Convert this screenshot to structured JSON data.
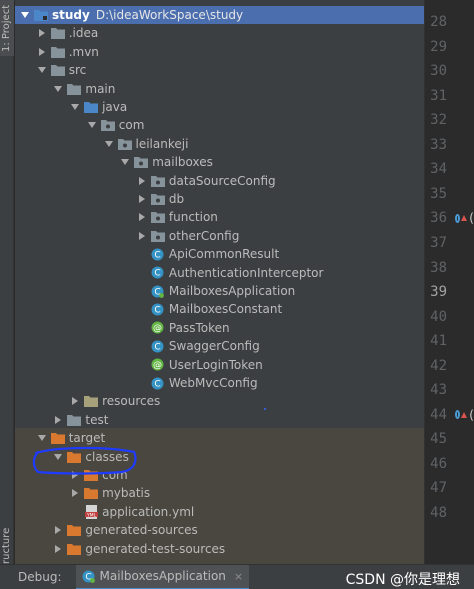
{
  "sidebar": {
    "project_tab": "1: Project",
    "structure_tab": "ructure"
  },
  "tree": [
    {
      "label": "study",
      "path": "D:\\ideaWorkSpace\\study",
      "arrow": "down",
      "icon": "module-folder-icon",
      "level": 0,
      "selected": true
    },
    {
      "label": ".idea",
      "arrow": "right",
      "icon": "folder-icon",
      "level": 1
    },
    {
      "label": ".mvn",
      "arrow": "right",
      "icon": "folder-icon",
      "level": 1
    },
    {
      "label": "src",
      "arrow": "down",
      "icon": "folder-icon",
      "level": 1
    },
    {
      "label": "main",
      "arrow": "down",
      "icon": "folder-icon",
      "level": 2
    },
    {
      "label": "java",
      "arrow": "down",
      "icon": "source-folder-icon",
      "level": 3
    },
    {
      "label": "com",
      "arrow": "down",
      "icon": "package-icon",
      "level": 4
    },
    {
      "label": "leilankeji",
      "arrow": "down",
      "icon": "package-icon",
      "level": 5
    },
    {
      "label": "mailboxes",
      "arrow": "down",
      "icon": "package-icon",
      "level": 6
    },
    {
      "label": "dataSourceConfig",
      "arrow": "right",
      "icon": "package-icon",
      "level": 7
    },
    {
      "label": "db",
      "arrow": "right",
      "icon": "package-icon",
      "level": 7
    },
    {
      "label": "function",
      "arrow": "right",
      "icon": "package-icon",
      "level": 7
    },
    {
      "label": "otherConfig",
      "arrow": "right",
      "icon": "package-icon",
      "level": 7
    },
    {
      "label": "ApiCommonResult",
      "arrow": "none",
      "icon": "class-icon",
      "level": 7
    },
    {
      "label": "AuthenticationInterceptor",
      "arrow": "none",
      "icon": "class-icon",
      "level": 7
    },
    {
      "label": "MailboxesApplication",
      "arrow": "none",
      "icon": "spring-boot-class-icon",
      "level": 7
    },
    {
      "label": "MailboxesConstant",
      "arrow": "none",
      "icon": "class-icon",
      "level": 7
    },
    {
      "label": "PassToken",
      "arrow": "none",
      "icon": "annotation-icon",
      "level": 7
    },
    {
      "label": "SwaggerConfig",
      "arrow": "none",
      "icon": "class-icon",
      "level": 7
    },
    {
      "label": "UserLoginToken",
      "arrow": "none",
      "icon": "annotation-icon",
      "level": 7
    },
    {
      "label": "WebMvcConfig",
      "arrow": "none",
      "icon": "class-icon",
      "level": 7
    },
    {
      "label": "resources",
      "arrow": "right",
      "icon": "resources-folder-icon",
      "level": 3
    },
    {
      "label": "test",
      "arrow": "right",
      "icon": "folder-icon",
      "level": 2
    },
    {
      "label": "target",
      "arrow": "down",
      "icon": "excluded-folder-icon",
      "level": 1
    },
    {
      "label": "classes",
      "arrow": "down",
      "icon": "excluded-folder-icon",
      "level": 2
    },
    {
      "label": "com",
      "arrow": "right",
      "icon": "excluded-folder-icon",
      "level": 3
    },
    {
      "label": "mybatis",
      "arrow": "right",
      "icon": "excluded-folder-icon",
      "level": 3
    },
    {
      "label": "application.yml",
      "arrow": "none",
      "icon": "yml-file-icon",
      "level": 3
    },
    {
      "label": "generated-sources",
      "arrow": "right",
      "icon": "excluded-folder-icon",
      "level": 2
    },
    {
      "label": "generated-test-sources",
      "arrow": "right",
      "icon": "excluded-folder-icon",
      "level": 2
    }
  ],
  "gutter": {
    "lines": [
      "28",
      "29",
      "30",
      "31",
      "32",
      "33",
      "34",
      "35",
      "36",
      "37",
      "38",
      "39",
      "40",
      "41",
      "42",
      "43",
      "44",
      "45",
      "46",
      "47",
      "48"
    ],
    "current_line": "39",
    "marked_lines": [
      "36",
      "44"
    ],
    "mark_char": "("
  },
  "status": {
    "debug_label": "Debug:",
    "tab_label": "MailboxesApplication",
    "close": "×",
    "watermark": "CSDN @你是理想"
  },
  "colors": {
    "folder": "#87939a",
    "source_folder": "#4a86c8",
    "package": "#87939a",
    "class": "#3592c4",
    "annotation": "#62b543",
    "excluded": "#d9792f",
    "selection": "#4b6eaf",
    "highlight_scribble": "#1f3bff"
  }
}
